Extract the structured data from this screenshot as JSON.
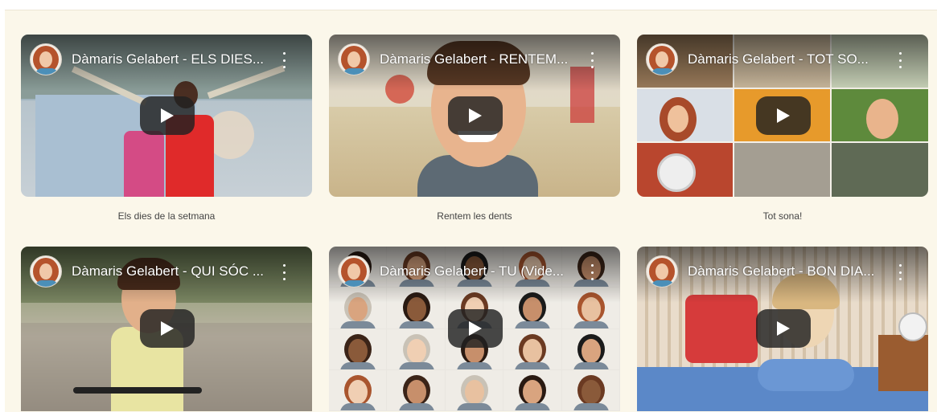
{
  "videos": [
    {
      "title": "Dàmaris Gelabert - ELS DIES...",
      "caption": "Els dies de la setmana"
    },
    {
      "title": "Dàmaris Gelabert - RENTEM...",
      "caption": "Rentem les dents"
    },
    {
      "title": "Dàmaris Gelabert - TOT SO...",
      "caption": "Tot sona!"
    },
    {
      "title": "Dàmaris Gelabert - QUI SÓC ...",
      "caption": ""
    },
    {
      "title": "Dàmaris Gelabert - TU (Vide...",
      "caption": ""
    },
    {
      "title": "Dàmaris Gelabert - BON DIA...",
      "caption": ""
    }
  ],
  "icons": {
    "play": "play-icon",
    "menu": "more-vertical-icon",
    "channel": "channel-avatar-icon"
  }
}
